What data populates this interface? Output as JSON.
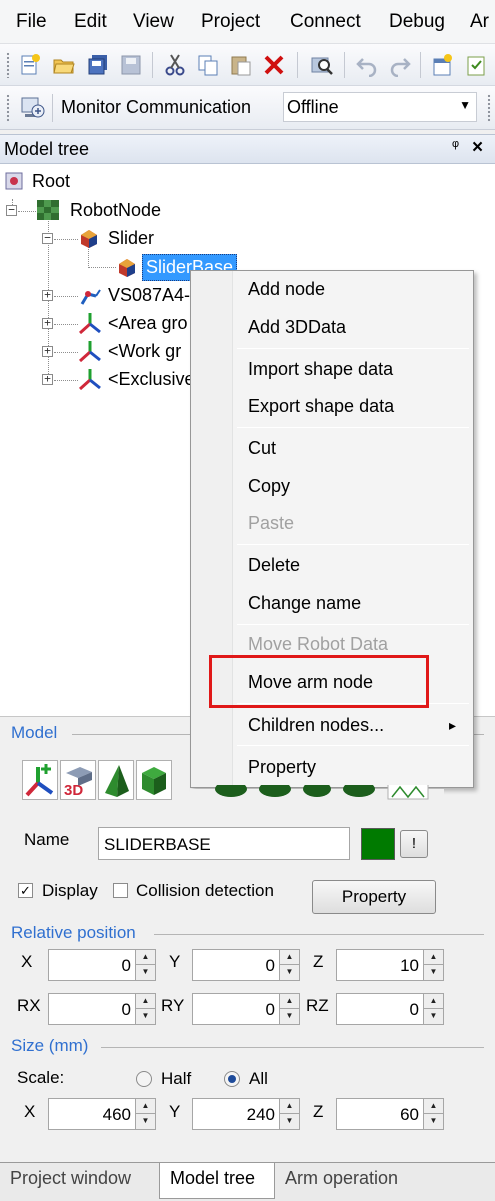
{
  "menubar": {
    "items": [
      "File",
      "Edit",
      "View",
      "Project",
      "Connect",
      "Debug",
      "Ar"
    ]
  },
  "toolbar2": {
    "label": "Monitor Communication",
    "status_value": "Offline"
  },
  "model_tree": {
    "title": "Model tree",
    "pin_glyph": "ᵠ",
    "close_glyph": "×",
    "nodes": [
      {
        "label": "Root"
      },
      {
        "label": "RobotNode"
      },
      {
        "label": "Slider"
      },
      {
        "label": "SliderBase"
      },
      {
        "label": "VS087A4-"
      },
      {
        "label": "<Area gro"
      },
      {
        "label": "<Work gr"
      },
      {
        "label": "<Exclusive"
      }
    ]
  },
  "context_menu": {
    "items": [
      {
        "label": "Add node",
        "enabled": true
      },
      {
        "label": "Add 3DData",
        "enabled": true
      },
      {
        "label": "Import shape data",
        "enabled": true
      },
      {
        "label": "Export shape data",
        "enabled": true
      },
      {
        "label": "Cut",
        "enabled": true
      },
      {
        "label": "Copy",
        "enabled": true
      },
      {
        "label": "Paste",
        "enabled": false
      },
      {
        "label": "Delete",
        "enabled": true
      },
      {
        "label": "Change name",
        "enabled": true
      },
      {
        "label": "Move Robot Data",
        "enabled": false
      },
      {
        "label": "Move arm node",
        "enabled": true,
        "highlighted": true
      },
      {
        "label": "Children nodes...",
        "enabled": true,
        "submenu": true
      },
      {
        "label": "Property",
        "enabled": true
      }
    ],
    "submenu_arrow": "▸"
  },
  "model": {
    "group_title": "Model",
    "icon_3d_label": "3D",
    "name_label": "Name",
    "name_value": "SLIDERBASE",
    "color_swatch": "#007a00",
    "color_button_label": "!",
    "display_label": "Display",
    "display_checked": true,
    "collision_label": "Collision detection",
    "collision_checked": false,
    "property_button": "Property"
  },
  "relative_position": {
    "title": "Relative position",
    "fields": [
      {
        "label": "X",
        "value": "0"
      },
      {
        "label": "Y",
        "value": "0"
      },
      {
        "label": "Z",
        "value": "10"
      },
      {
        "label": "RX",
        "value": "0"
      },
      {
        "label": "RY",
        "value": "0"
      },
      {
        "label": "RZ",
        "value": "0"
      }
    ]
  },
  "size": {
    "title": "Size (mm)",
    "scale_label": "Scale:",
    "half_label": "Half",
    "all_label": "All",
    "selected": "All",
    "fields": [
      {
        "label": "X",
        "value": "460"
      },
      {
        "label": "Y",
        "value": "240"
      },
      {
        "label": "Z",
        "value": "60"
      }
    ]
  },
  "tabs": [
    {
      "label": "Project window",
      "active": false
    },
    {
      "label": "Model tree",
      "active": true
    },
    {
      "label": "Arm operation",
      "active": false
    }
  ],
  "colors": {
    "accent_blue": "#3070d0",
    "selection": "#3399ff",
    "highlight_red": "#e01818"
  }
}
